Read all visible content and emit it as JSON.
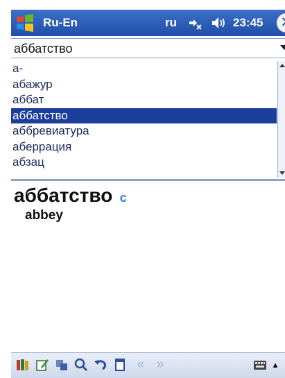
{
  "titlebar": {
    "app_title": "Ru-En",
    "language": "ru",
    "time": "23:45",
    "close_glyph": "✕"
  },
  "search": {
    "value": "аббатство"
  },
  "word_list": {
    "items": [
      "а-",
      "абажур",
      "аббат",
      "аббатство",
      "аббревиатура",
      "аберрация",
      "абзац"
    ],
    "selected_index": 3
  },
  "article": {
    "headword": "аббатство",
    "translation": "abbey"
  },
  "toolbar": {
    "icons": [
      "dictionary-icon",
      "edit-icon",
      "sync-icon",
      "search-icon",
      "undo-icon",
      "card-icon",
      "back-icon",
      "forward-icon",
      "keyboard-icon"
    ]
  },
  "colors": {
    "titlebar": "#2a5bb8",
    "selection": "#1b3e9c",
    "accent": "#3b7be0"
  }
}
